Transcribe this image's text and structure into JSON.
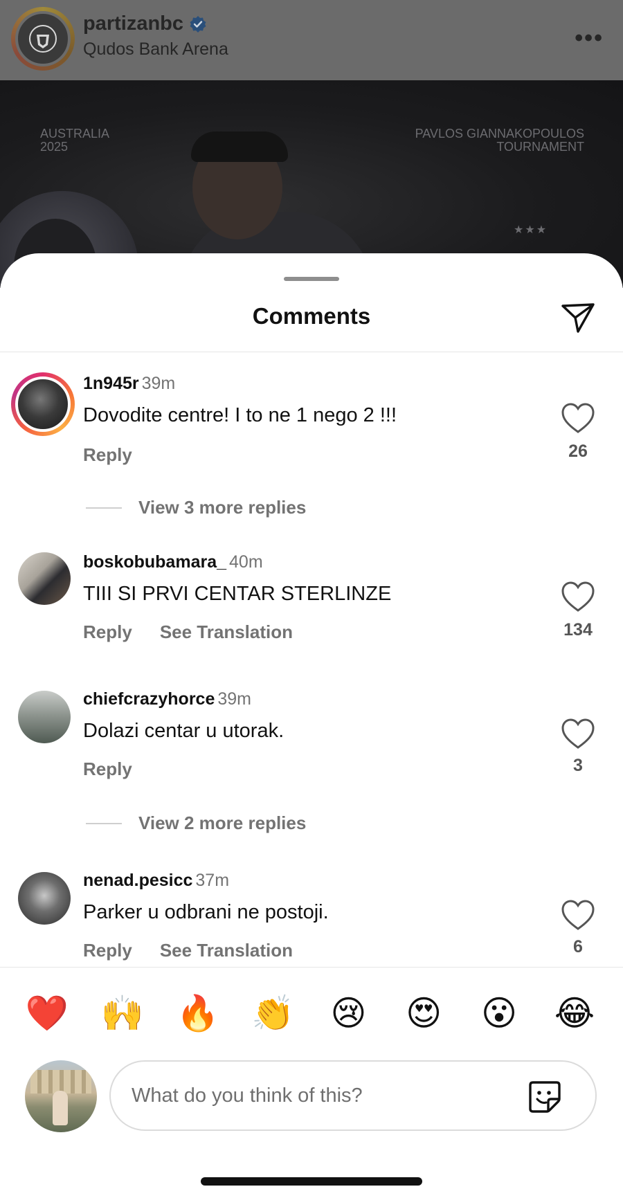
{
  "post": {
    "username": "partizanbc",
    "location": "Qudos Bank Arena",
    "more_label": "•••",
    "image_text_left": [
      "AUSTRALIA",
      "2025"
    ],
    "image_text_right": [
      "PAVLOS GIANNAKOPOULOS",
      "TOURNAMENT"
    ]
  },
  "sheet": {
    "title": "Comments"
  },
  "comments": [
    {
      "username": "1n945r",
      "time": "39m",
      "text": "Dovodite centre!  I to ne 1 nego 2 !!!",
      "reply_label": "Reply",
      "translate_label": "",
      "likes": "26",
      "view_replies": "View 3 more replies"
    },
    {
      "username": "boskobubamara_",
      "time": "40m",
      "text": "TIII SI PRVI CENTAR STERLINZE",
      "reply_label": "Reply",
      "translate_label": "See Translation",
      "likes": "134",
      "view_replies": ""
    },
    {
      "username": "chiefcrazyhorce",
      "time": "39m",
      "text": "Dolazi centar u utorak.",
      "reply_label": "Reply",
      "translate_label": "",
      "likes": "3",
      "view_replies": "View 2 more replies"
    },
    {
      "username": "nenad.pesicc",
      "time": "37m",
      "text": "Parker u odbrani ne postoji.",
      "reply_label": "Reply",
      "translate_label": "See Translation",
      "likes": "6",
      "view_replies": ""
    }
  ],
  "reactions": [
    "❤️",
    "🙌",
    "🔥",
    "👏",
    "😢",
    "😍",
    "😮",
    "😂"
  ],
  "composer": {
    "placeholder": "What do you think of this?",
    "value": ""
  },
  "colors": {
    "accent_verified": "#3897f0",
    "story_ring": "#e1306c",
    "muted_text": "#737373"
  },
  "icons": {
    "verified": "verified-badge-icon",
    "share": "paper-plane-icon",
    "like": "heart-outline-icon",
    "sticker": "sticker-icon"
  }
}
